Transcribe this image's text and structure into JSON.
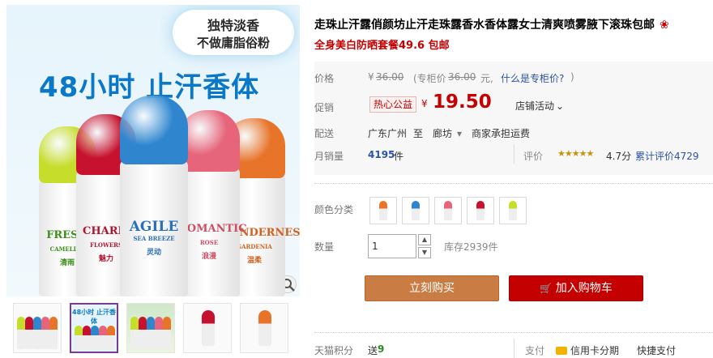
{
  "hero": {
    "cloud_line1": "独特淡香",
    "cloud_line2": "不做庸脂俗粉",
    "slogan": "48小时 止汗香体",
    "bottles": [
      {
        "name": "FRESH",
        "sub": "CAMELLIA",
        "cn": "清雨",
        "cap_color": "#c6dd2c",
        "text_color": "#3c8f1b"
      },
      {
        "name": "CHARM",
        "sub": "FLOWERS",
        "cn": "魅力",
        "cap_color": "#c6122e",
        "text_color": "#b0142d"
      },
      {
        "name": "AGILE",
        "sub": "SEA BREEZE",
        "cn": "灵动",
        "cap_color": "#2f86cf",
        "text_color": "#2a6fba"
      },
      {
        "name": "ROMANTIC",
        "sub": "ROSE",
        "cn": "浪漫",
        "cap_color": "#e6657a",
        "text_color": "#cc4d62"
      },
      {
        "name": "TENDERNESS",
        "sub": "GARDENIA",
        "cn": "温柔",
        "cap_color": "#e8742a",
        "text_color": "#d2601e"
      }
    ]
  },
  "thumbs": {
    "items": [
      {
        "caption": "",
        "active": false
      },
      {
        "caption": "48小时 止汗香体",
        "active": true
      },
      {
        "caption": "",
        "active": false
      },
      {
        "caption": "",
        "active": false
      },
      {
        "caption": "",
        "active": false
      }
    ]
  },
  "product": {
    "title": "走珠止汗露俏颜坊止汗走珠露香水香体露女士清爽喷雾腋下滚珠包邮",
    "title_icon": "❀",
    "subtitle": "全身美白防晒套餐49.6 包邮"
  },
  "price_panel": {
    "price_label": "价格",
    "orig_price_symbol": "¥",
    "orig_price": "36.00",
    "cabinet_prefix": "(专柜价",
    "cabinet_price": "36.00",
    "cabinet_suffix": "元,",
    "cabinet_link": "什么是专柜价?",
    "cabinet_close": ")",
    "promo_label": "促销",
    "promo_badge": "热心公益",
    "promo_symbol": "¥",
    "promo_price": "19.50",
    "shop_activity": "店铺活动",
    "chevron": "⌄"
  },
  "shipping": {
    "label": "配送",
    "from": "广东广州",
    "to_word": "至",
    "to": "廊坊",
    "dropdown": "▾",
    "fee": "商家承担运费"
  },
  "sales": {
    "label": "月销量",
    "count": "4195",
    "unit": "件",
    "rating_label": "评价",
    "stars": "★★★★★",
    "score": "4.7分",
    "total_label": "累计评价",
    "total": "4729"
  },
  "options": {
    "color_label": "颜色分类",
    "swatches": [
      "#e8742a",
      "#2f86cf",
      "#e6657a",
      "#c6122e",
      "#c6dd2c"
    ],
    "qty_label": "数量",
    "qty_value": "1",
    "stock": "库存2939件",
    "up": "▲",
    "down": "▼"
  },
  "actions": {
    "buy_label": "立刻购买",
    "cart_icon": "🛒",
    "cart_label": "加入购物车"
  },
  "footer": {
    "points_label": "天猫积分",
    "points_prefix": "送",
    "points_value": "9",
    "pay_label": "支付",
    "credit": "信用卡分期",
    "express": "快捷支付"
  }
}
